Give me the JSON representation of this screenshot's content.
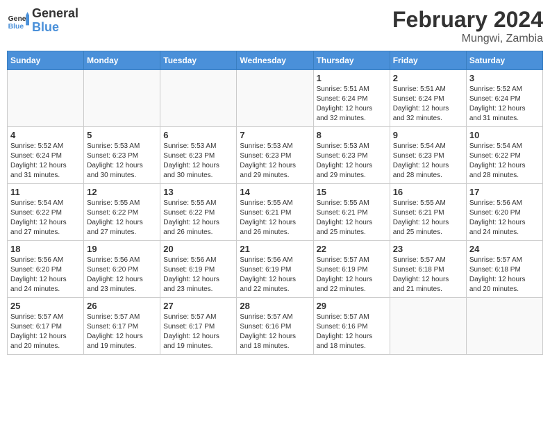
{
  "header": {
    "logo_line1": "General",
    "logo_line2": "Blue",
    "title": "February 2024",
    "location": "Mungwi, Zambia"
  },
  "weekdays": [
    "Sunday",
    "Monday",
    "Tuesday",
    "Wednesday",
    "Thursday",
    "Friday",
    "Saturday"
  ],
  "weeks": [
    [
      {
        "day": "",
        "detail": ""
      },
      {
        "day": "",
        "detail": ""
      },
      {
        "day": "",
        "detail": ""
      },
      {
        "day": "",
        "detail": ""
      },
      {
        "day": "1",
        "detail": "Sunrise: 5:51 AM\nSunset: 6:24 PM\nDaylight: 12 hours\nand 32 minutes."
      },
      {
        "day": "2",
        "detail": "Sunrise: 5:51 AM\nSunset: 6:24 PM\nDaylight: 12 hours\nand 32 minutes."
      },
      {
        "day": "3",
        "detail": "Sunrise: 5:52 AM\nSunset: 6:24 PM\nDaylight: 12 hours\nand 31 minutes."
      }
    ],
    [
      {
        "day": "4",
        "detail": "Sunrise: 5:52 AM\nSunset: 6:24 PM\nDaylight: 12 hours\nand 31 minutes."
      },
      {
        "day": "5",
        "detail": "Sunrise: 5:53 AM\nSunset: 6:23 PM\nDaylight: 12 hours\nand 30 minutes."
      },
      {
        "day": "6",
        "detail": "Sunrise: 5:53 AM\nSunset: 6:23 PM\nDaylight: 12 hours\nand 30 minutes."
      },
      {
        "day": "7",
        "detail": "Sunrise: 5:53 AM\nSunset: 6:23 PM\nDaylight: 12 hours\nand 29 minutes."
      },
      {
        "day": "8",
        "detail": "Sunrise: 5:53 AM\nSunset: 6:23 PM\nDaylight: 12 hours\nand 29 minutes."
      },
      {
        "day": "9",
        "detail": "Sunrise: 5:54 AM\nSunset: 6:23 PM\nDaylight: 12 hours\nand 28 minutes."
      },
      {
        "day": "10",
        "detail": "Sunrise: 5:54 AM\nSunset: 6:22 PM\nDaylight: 12 hours\nand 28 minutes."
      }
    ],
    [
      {
        "day": "11",
        "detail": "Sunrise: 5:54 AM\nSunset: 6:22 PM\nDaylight: 12 hours\nand 27 minutes."
      },
      {
        "day": "12",
        "detail": "Sunrise: 5:55 AM\nSunset: 6:22 PM\nDaylight: 12 hours\nand 27 minutes."
      },
      {
        "day": "13",
        "detail": "Sunrise: 5:55 AM\nSunset: 6:22 PM\nDaylight: 12 hours\nand 26 minutes."
      },
      {
        "day": "14",
        "detail": "Sunrise: 5:55 AM\nSunset: 6:21 PM\nDaylight: 12 hours\nand 26 minutes."
      },
      {
        "day": "15",
        "detail": "Sunrise: 5:55 AM\nSunset: 6:21 PM\nDaylight: 12 hours\nand 25 minutes."
      },
      {
        "day": "16",
        "detail": "Sunrise: 5:55 AM\nSunset: 6:21 PM\nDaylight: 12 hours\nand 25 minutes."
      },
      {
        "day": "17",
        "detail": "Sunrise: 5:56 AM\nSunset: 6:20 PM\nDaylight: 12 hours\nand 24 minutes."
      }
    ],
    [
      {
        "day": "18",
        "detail": "Sunrise: 5:56 AM\nSunset: 6:20 PM\nDaylight: 12 hours\nand 24 minutes."
      },
      {
        "day": "19",
        "detail": "Sunrise: 5:56 AM\nSunset: 6:20 PM\nDaylight: 12 hours\nand 23 minutes."
      },
      {
        "day": "20",
        "detail": "Sunrise: 5:56 AM\nSunset: 6:19 PM\nDaylight: 12 hours\nand 23 minutes."
      },
      {
        "day": "21",
        "detail": "Sunrise: 5:56 AM\nSunset: 6:19 PM\nDaylight: 12 hours\nand 22 minutes."
      },
      {
        "day": "22",
        "detail": "Sunrise: 5:57 AM\nSunset: 6:19 PM\nDaylight: 12 hours\nand 22 minutes."
      },
      {
        "day": "23",
        "detail": "Sunrise: 5:57 AM\nSunset: 6:18 PM\nDaylight: 12 hours\nand 21 minutes."
      },
      {
        "day": "24",
        "detail": "Sunrise: 5:57 AM\nSunset: 6:18 PM\nDaylight: 12 hours\nand 20 minutes."
      }
    ],
    [
      {
        "day": "25",
        "detail": "Sunrise: 5:57 AM\nSunset: 6:17 PM\nDaylight: 12 hours\nand 20 minutes."
      },
      {
        "day": "26",
        "detail": "Sunrise: 5:57 AM\nSunset: 6:17 PM\nDaylight: 12 hours\nand 19 minutes."
      },
      {
        "day": "27",
        "detail": "Sunrise: 5:57 AM\nSunset: 6:17 PM\nDaylight: 12 hours\nand 19 minutes."
      },
      {
        "day": "28",
        "detail": "Sunrise: 5:57 AM\nSunset: 6:16 PM\nDaylight: 12 hours\nand 18 minutes."
      },
      {
        "day": "29",
        "detail": "Sunrise: 5:57 AM\nSunset: 6:16 PM\nDaylight: 12 hours\nand 18 minutes."
      },
      {
        "day": "",
        "detail": ""
      },
      {
        "day": "",
        "detail": ""
      }
    ]
  ]
}
